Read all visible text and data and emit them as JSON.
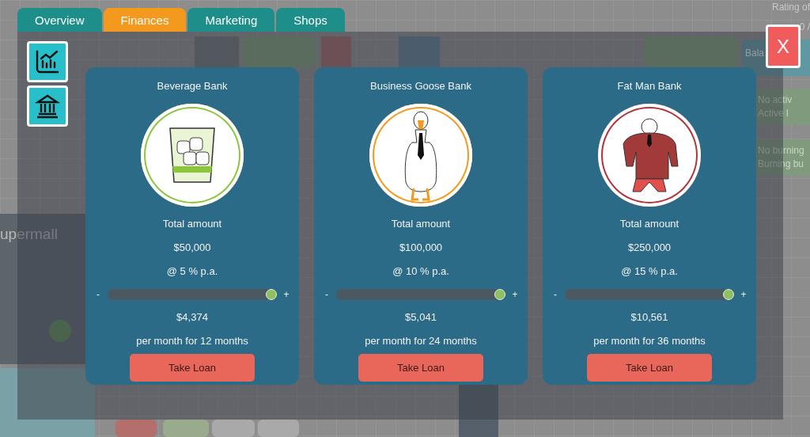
{
  "background": {
    "mall_label": "upermall",
    "rating_label": "Rating of",
    "rating_value": "0 /",
    "balance_label": "Bala",
    "loan_lines": [
      "No activ",
      "Active l"
    ],
    "burning_lines": [
      "No burning",
      "Burning bu"
    ]
  },
  "tabs": [
    {
      "label": "Overview",
      "selected": false
    },
    {
      "label": "Finances",
      "selected": true
    },
    {
      "label": "Marketing",
      "selected": false
    },
    {
      "label": "Shops",
      "selected": false
    }
  ],
  "side_buttons": [
    {
      "kind": "chart"
    },
    {
      "kind": "bank"
    }
  ],
  "close_button": {
    "label": "X"
  },
  "banks": [
    {
      "name": "Beverage Bank",
      "kind": "glass",
      "color": "#8cc63f",
      "total_label": "Total amount",
      "amount": "$50,000",
      "rate": "@ 5 % p.a.",
      "minus": "-",
      "plus": "+",
      "level": 1,
      "payment": "$4,374",
      "term": "per month for 12 months",
      "button": "Take Loan"
    },
    {
      "name": "Business Goose Bank",
      "kind": "goose",
      "color": "#f39a1e",
      "total_label": "Total amount",
      "amount": "$100,000",
      "rate": "@ 10 % p.a.",
      "minus": "-",
      "plus": "+",
      "level": 1,
      "payment": "$5,041",
      "term": "per month for 24 months",
      "button": "Take Loan"
    },
    {
      "name": "Fat Man Bank",
      "kind": "man",
      "color": "#b3343a",
      "total_label": "Total amount",
      "amount": "$250,000",
      "rate": "@ 15 % p.a.",
      "minus": "-",
      "plus": "+",
      "level": 1,
      "payment": "$10,561",
      "term": "per month for 36 months",
      "button": "Take Loan"
    }
  ]
}
